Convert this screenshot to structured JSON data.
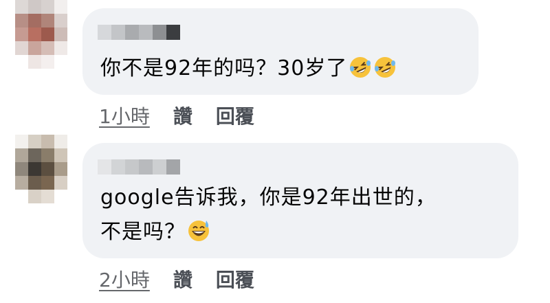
{
  "comments": [
    {
      "text": "你不是92年的吗？30岁了",
      "emojis": [
        "rolling-on-floor-laughing",
        "rolling-on-floor-laughing"
      ],
      "time": "1小時",
      "like_label": "讚",
      "reply_label": "回覆"
    },
    {
      "text_line1": "google告诉我，你是92年出世的，",
      "text_line2": "不是吗？",
      "emojis": [
        "grinning-face-with-sweat"
      ],
      "time": "2小時",
      "like_label": "讚",
      "reply_label": "回覆"
    }
  ],
  "colors": {
    "bubble": "#f0f2f5",
    "text": "#050505",
    "meta": "#65676b"
  }
}
